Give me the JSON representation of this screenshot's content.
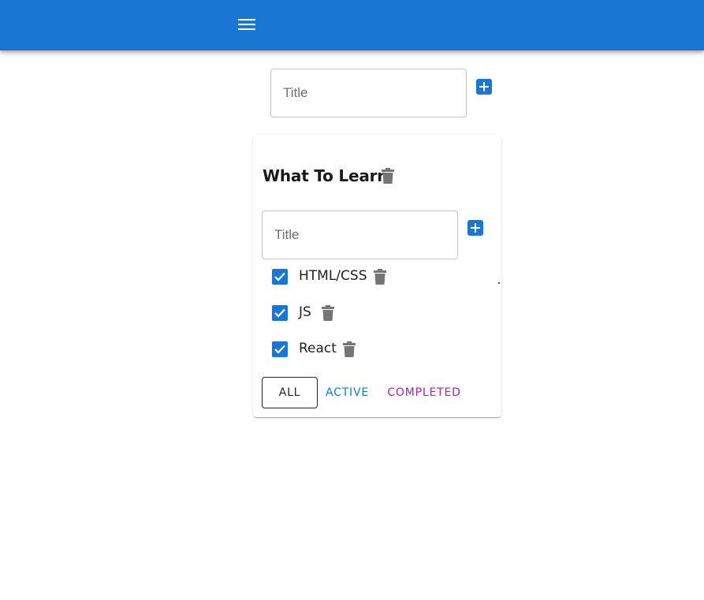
{
  "appbar": {
    "menu_icon": "menu-icon",
    "color": "#1976d2"
  },
  "new_list": {
    "placeholder": "Title",
    "value": "",
    "add_icon": "add-box-icon"
  },
  "list": {
    "title": "What To Learn",
    "delete_icon": "trash-icon",
    "new_task": {
      "placeholder": "Title",
      "value": ""
    },
    "tasks": [
      {
        "label": "HTML/CSS",
        "checked": true
      },
      {
        "label": "JS",
        "checked": true
      },
      {
        "label": "React",
        "checked": true
      }
    ],
    "filters": {
      "all": "ALL",
      "active": "ACTIVE",
      "completed": "COMPLETED"
    }
  },
  "colors": {
    "primary": "#1976d2",
    "secondary": "#9c27b0",
    "icon_gray": "#757575"
  }
}
